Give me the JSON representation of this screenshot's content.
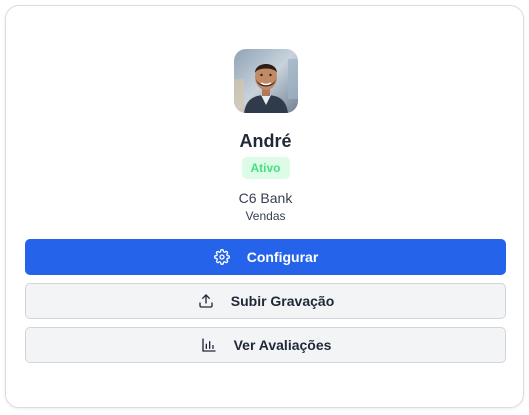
{
  "profile": {
    "name": "André",
    "status": "Ativo",
    "company": "C6 Bank",
    "department": "Vendas",
    "avatar_alt": "André"
  },
  "actions": {
    "configure_label": "Configurar",
    "configure_icon": "gear-icon",
    "upload_label": "Subir Gravação",
    "upload_icon": "upload-icon",
    "reviews_label": "Ver Avaliações",
    "reviews_icon": "bar-chart-icon"
  },
  "colors": {
    "primary": "#2563eb",
    "badge_bg": "#dcfce7",
    "badge_text": "#4ade80",
    "secondary_bg": "#f3f4f6",
    "border": "#d1d5db"
  }
}
